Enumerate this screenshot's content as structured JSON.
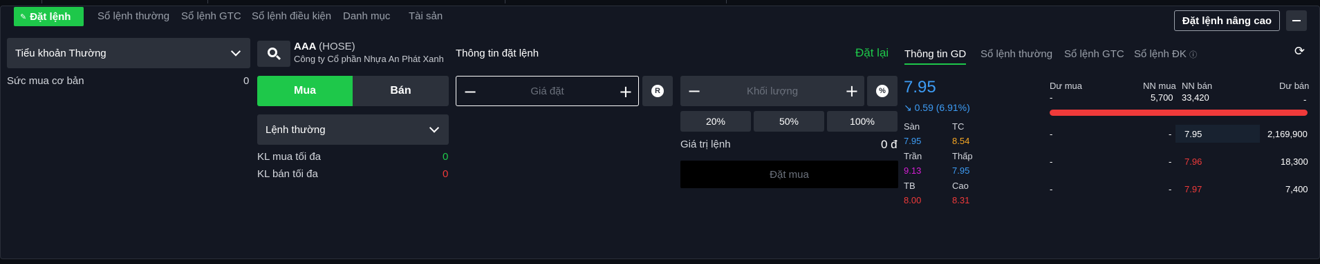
{
  "tabs": [
    {
      "label": "Đặt lệnh",
      "active": true
    },
    {
      "label": "Sổ lệnh thường"
    },
    {
      "label": "Sổ lệnh GTC"
    },
    {
      "label": "Sổ lệnh điều kiện"
    },
    {
      "label": "Danh mục"
    },
    {
      "label": "Tài sản"
    }
  ],
  "header": {
    "advanced_label": "Đặt lệnh nâng cao"
  },
  "account": {
    "select_value": "Tiểu khoản Thường",
    "buying_power_label": "Sức mua cơ bản",
    "buying_power_value": "0"
  },
  "stock": {
    "symbol": "AAA",
    "exchange": "(HOSE)",
    "company": "Công ty Cổ phần Nhựa An Phát Xanh"
  },
  "side": {
    "buy": "Mua",
    "sell": "Bán"
  },
  "order_type": {
    "value": "Lệnh thường"
  },
  "limits": {
    "max_buy_label": "KL mua tối đa",
    "max_buy_value": "0",
    "max_sell_label": "KL bán tối đa",
    "max_sell_value": "0"
  },
  "order_info": {
    "title": "Thông tin đặt lệnh",
    "reset": "Đặt lại",
    "price_placeholder": "Giá đặt",
    "volume_placeholder": "Khối lượng",
    "price_btn": "R",
    "volume_btn": "%",
    "percents": [
      "20%",
      "50%",
      "100%"
    ],
    "value_label": "Giá trị lệnh",
    "value": "0 đ",
    "submit": "Đặt mua"
  },
  "info_tabs": [
    "Thông tin GD",
    "Sổ lệnh thường",
    "Sổ lệnh GTC",
    "Sổ lệnh ĐK"
  ],
  "quote": {
    "price": "7.95",
    "change": "↘ 0.59 (6.91%)",
    "floor_label": "Sàn",
    "floor": "7.95",
    "ref_label": "TC",
    "ref": "8.54",
    "ceil_label": "Trần",
    "ceil": "9.13",
    "low_label": "Thấp",
    "low": "7.95",
    "avg_label": "TB",
    "avg": "8.00",
    "high_label": "Cao",
    "high": "8.31"
  },
  "orderbook": {
    "headers": {
      "bid_vol": "Dư mua",
      "foreign_buy": "NN mua",
      "foreign_sell": "NN bán",
      "ask_vol": "Dư bán"
    },
    "summary": {
      "bid_vol": "-",
      "foreign_buy": "5,700",
      "foreign_sell": "33,420",
      "ask_vol": "-"
    },
    "rows": [
      {
        "bid_vol": "-",
        "bid_price": "-",
        "ask_price": "7.95",
        "ask_vol": "2,169,900"
      },
      {
        "bid_vol": "-",
        "bid_price": "-",
        "ask_price": "7.96",
        "ask_vol": "18,300"
      },
      {
        "bid_vol": "-",
        "bid_price": "-",
        "ask_price": "7.97",
        "ask_vol": "7,400"
      }
    ]
  },
  "colors": {
    "accent": "#1ec84a",
    "down": "#f03a3a",
    "floor": "#3d9cf5",
    "ref": "#f5a623",
    "ceil": "#d61ed6"
  },
  "icons": [
    "search-icon",
    "chevron-down-icon",
    "minus-icon",
    "plus-icon",
    "refresh-icon",
    "info-icon",
    "cart-icon"
  ]
}
